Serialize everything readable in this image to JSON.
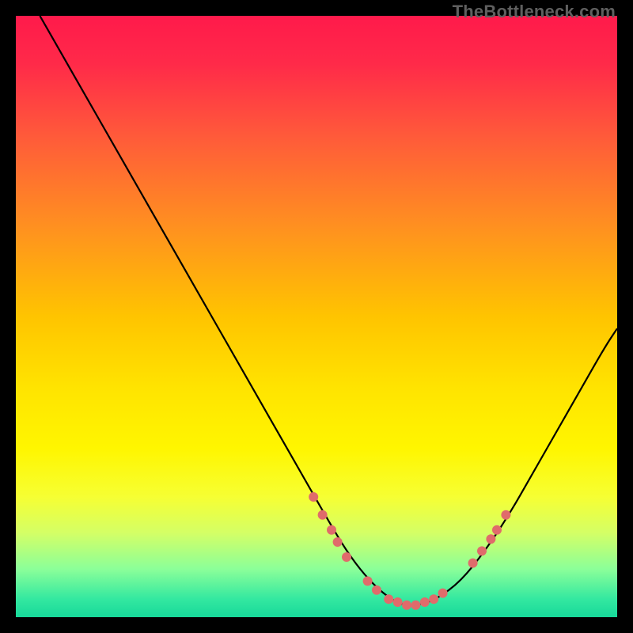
{
  "watermark": "TheBottleneck.com",
  "chart_data": {
    "type": "line",
    "title": "",
    "xlabel": "",
    "ylabel": "",
    "xlim": [
      0,
      100
    ],
    "ylim": [
      0,
      100
    ],
    "grid": false,
    "legend": false,
    "background_gradient": {
      "stops": [
        {
          "offset": 0.0,
          "color": "#ff1a4b"
        },
        {
          "offset": 0.08,
          "color": "#ff2a49"
        },
        {
          "offset": 0.2,
          "color": "#ff5a3a"
        },
        {
          "offset": 0.35,
          "color": "#ff9020"
        },
        {
          "offset": 0.5,
          "color": "#ffc400"
        },
        {
          "offset": 0.62,
          "color": "#ffe400"
        },
        {
          "offset": 0.72,
          "color": "#fff600"
        },
        {
          "offset": 0.8,
          "color": "#f6ff33"
        },
        {
          "offset": 0.86,
          "color": "#d4ff66"
        },
        {
          "offset": 0.92,
          "color": "#8bff99"
        },
        {
          "offset": 0.97,
          "color": "#33e8a0"
        },
        {
          "offset": 1.0,
          "color": "#17d99a"
        }
      ]
    },
    "series": [
      {
        "name": "bottleneck-curve",
        "color": "#000000",
        "x": [
          4,
          8,
          12,
          16,
          20,
          24,
          28,
          32,
          36,
          40,
          44,
          48,
          52,
          55,
          58,
          61,
          64,
          67,
          70,
          74,
          78,
          82,
          86,
          90,
          94,
          98,
          100
        ],
        "y": [
          100,
          93,
          86,
          79,
          72,
          65,
          58,
          51,
          44,
          37,
          30,
          23,
          16,
          11,
          7,
          4,
          2,
          2,
          3,
          6,
          11,
          17,
          24,
          31,
          38,
          45,
          48
        ]
      }
    ],
    "markers": {
      "name": "highlight-points",
      "color": "#e06b6b",
      "radius": 6,
      "points": [
        {
          "x": 49.5,
          "y": 20.0
        },
        {
          "x": 51.0,
          "y": 17.0
        },
        {
          "x": 52.5,
          "y": 14.5
        },
        {
          "x": 53.5,
          "y": 12.5
        },
        {
          "x": 55.0,
          "y": 10.0
        },
        {
          "x": 58.5,
          "y": 6.0
        },
        {
          "x": 60.0,
          "y": 4.5
        },
        {
          "x": 62.0,
          "y": 3.0
        },
        {
          "x": 63.5,
          "y": 2.5
        },
        {
          "x": 65.0,
          "y": 2.0
        },
        {
          "x": 66.5,
          "y": 2.0
        },
        {
          "x": 68.0,
          "y": 2.5
        },
        {
          "x": 69.5,
          "y": 3.0
        },
        {
          "x": 71.0,
          "y": 4.0
        },
        {
          "x": 76.0,
          "y": 9.0
        },
        {
          "x": 77.5,
          "y": 11.0
        },
        {
          "x": 79.0,
          "y": 13.0
        },
        {
          "x": 80.0,
          "y": 14.5
        },
        {
          "x": 81.5,
          "y": 17.0
        }
      ]
    }
  }
}
